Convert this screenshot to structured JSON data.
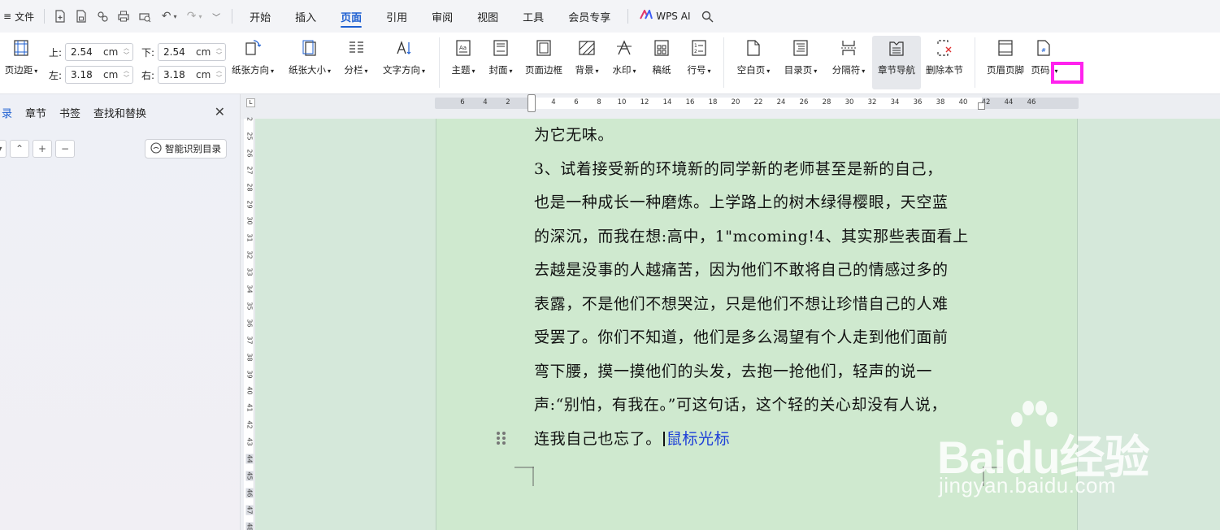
{
  "menubar": {
    "file": "文件",
    "tabs": [
      "开始",
      "插入",
      "页面",
      "引用",
      "审阅",
      "视图",
      "工具",
      "会员专享"
    ],
    "active_tab": "页面",
    "ai_label": "WPS AI",
    "accent_color": "#1d5fd1"
  },
  "ribbon": {
    "margins_label": "页边距",
    "top_label": "上:",
    "top_value": "2.54",
    "bottom_label": "下:",
    "bottom_value": "2.54",
    "left_label": "左:",
    "left_value": "3.18",
    "right_label": "右:",
    "right_value": "3.18",
    "unit": "cm",
    "orientation": "纸张方向",
    "size": "纸张大小",
    "columns": "分栏",
    "text_direction": "文字方向",
    "theme": "主题",
    "cover": "封面",
    "page_border": "页面边框",
    "background": "背景",
    "watermark": "水印",
    "manuscript": "稿纸",
    "line_number": "行号",
    "blank_page": "空白页",
    "toc_page": "目录页",
    "separator": "分隔符",
    "chapter_nav": "章节导航",
    "delete_section": "删除本节",
    "header_footer": "页眉页脚",
    "page_number": "页码",
    "highlight_color": "#ff22ee"
  },
  "nav": {
    "tab_toc": "录",
    "tab_chapter": "章节",
    "tab_bookmark": "书签",
    "tab_find": "查找和替换",
    "smart_toc": "智能识别目录"
  },
  "ruler": {
    "h_ticks": [
      "6",
      "4",
      "2",
      "2",
      "4",
      "6",
      "8",
      "10",
      "12",
      "14",
      "16",
      "18",
      "20",
      "22",
      "24",
      "26",
      "28",
      "30",
      "32",
      "34",
      "36",
      "38",
      "40",
      "42",
      "44",
      "46"
    ],
    "v_ticks": [
      "2",
      "25",
      "26",
      "27",
      "28",
      "29",
      "30",
      "31",
      "32",
      "33",
      "34",
      "35",
      "36",
      "37",
      "38",
      "39",
      "40",
      "41",
      "42",
      "43",
      "44",
      "45",
      "46",
      "47",
      "48"
    ]
  },
  "document": {
    "lines": [
      "为它无味。",
      "3、试着接受新的环境新的同学新的老师甚至是新的自己，",
      "也是一种成长一种磨炼。上学路上的树木绿得樱眼，天空蓝",
      "的深沉，而我在想:高中，1\"mcoming!4、其实那些表面看上",
      "去越是没事的人越痛苦，因为他们不敢将自己的情感过多的",
      "表露，不是他们不想哭泣，只是他们不想让珍惜自己的人难",
      "受罢了。你们不知道，他们是多么渴望有个人走到他们面前",
      "弯下腰，摸一摸他们的头发，去抱一抢他们，轻声的说一",
      "声:“别怕，有我在。”可这句话，这个轻的关心却没有人说，"
    ],
    "last_line": "连我自己也忘了。",
    "cursor_note": "鼠标光标"
  },
  "watermark": {
    "main": "Baidu经验",
    "sub": "jingyan.baidu.com"
  }
}
